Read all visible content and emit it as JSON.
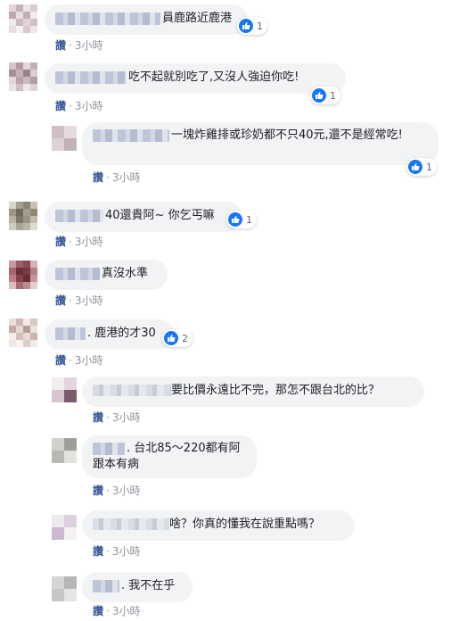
{
  "like_label": "讚",
  "comments": [
    {
      "text": "員鹿路近鹿港",
      "likes": "1",
      "time": "3小時"
    },
    {
      "text": "吃不起就別吃了,又沒人強迫你吃!",
      "likes": "1",
      "time": "3小時"
    },
    {
      "text": "一塊炸雞排或珍奶都不只40元,還不是經常吃!",
      "likes": "1",
      "time": "3小時"
    },
    {
      "text": "40還貴阿~ 你乞丐嘛",
      "likes": "1",
      "time": "3小時"
    },
    {
      "text": "真沒水準",
      "time": "3小時"
    },
    {
      "text": ". 鹿港的才30",
      "likes": "2",
      "time": "3小時"
    },
    {
      "text": "要比價永遠比不完，那怎不跟台北的比？",
      "time": "3小時"
    },
    {
      "text_line1": ". 台北85～220都有阿",
      "text_line2": "跟本有病",
      "time": "3小時"
    },
    {
      "text": "啥？你真的懂我在說重點嗎？",
      "time": "3小時"
    },
    {
      "text": ". 我不在乎",
      "time": "3小時"
    }
  ],
  "colors": {
    "like_blue": "#1877f2",
    "link_blue": "#385898",
    "bubble_bg": "#f2f3f5"
  }
}
